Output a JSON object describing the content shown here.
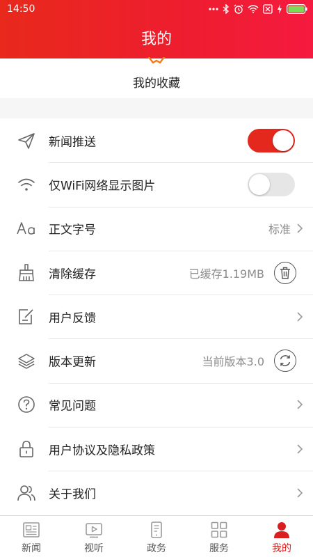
{
  "status_bar": {
    "time": "14:50"
  },
  "header": {
    "title": "我的"
  },
  "favorites": {
    "label": "我的收藏"
  },
  "settings": {
    "items": [
      {
        "label": "新闻推送",
        "control": "toggle",
        "state": "on"
      },
      {
        "label": "仅WiFi网络显示图片",
        "control": "toggle",
        "state": "off"
      },
      {
        "label": "正文字号",
        "value": "标准",
        "control": "arrow"
      },
      {
        "label": "清除缓存",
        "value": "已缓存1.19MB",
        "control": "trash-button"
      },
      {
        "label": "用户反馈",
        "control": "arrow"
      },
      {
        "label": "版本更新",
        "value": "当前版本3.0",
        "control": "refresh-button"
      },
      {
        "label": "常见问题",
        "control": "arrow"
      },
      {
        "label": "用户协议及隐私政策",
        "control": "arrow"
      },
      {
        "label": "关于我们",
        "control": "arrow"
      }
    ]
  },
  "tabbar": {
    "items": [
      {
        "label": "新闻"
      },
      {
        "label": "视听"
      },
      {
        "label": "政务"
      },
      {
        "label": "服务"
      },
      {
        "label": "我的",
        "active": true
      }
    ]
  },
  "colors": {
    "accent": "#e5281e",
    "header": "#ee1d2f",
    "active_tab": "#d81e1e"
  }
}
